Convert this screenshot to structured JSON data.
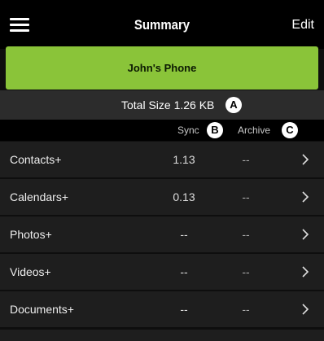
{
  "navbar": {
    "title": "Summary",
    "edit_label": "Edit",
    "menu_icon": "hamburger-icon"
  },
  "device": {
    "name": "John's Phone",
    "accent_color": "#8ac439"
  },
  "summary": {
    "total_size": "Total Size 1.26 KB",
    "badge_a": "A"
  },
  "columns": {
    "sync": "Sync",
    "badge_b": "B",
    "archive": "Archive",
    "badge_c": "C"
  },
  "rows": [
    {
      "label": "Contacts+",
      "sync": "1.13",
      "archive": "--"
    },
    {
      "label": "Calendars+",
      "sync": "0.13",
      "archive": "--"
    },
    {
      "label": "Photos+",
      "sync": "--",
      "archive": "--"
    },
    {
      "label": "Videos+",
      "sync": "--",
      "archive": "--"
    },
    {
      "label": "Documents+",
      "sync": "--",
      "archive": "--"
    }
  ],
  "row_icon": "chevron-right-icon"
}
